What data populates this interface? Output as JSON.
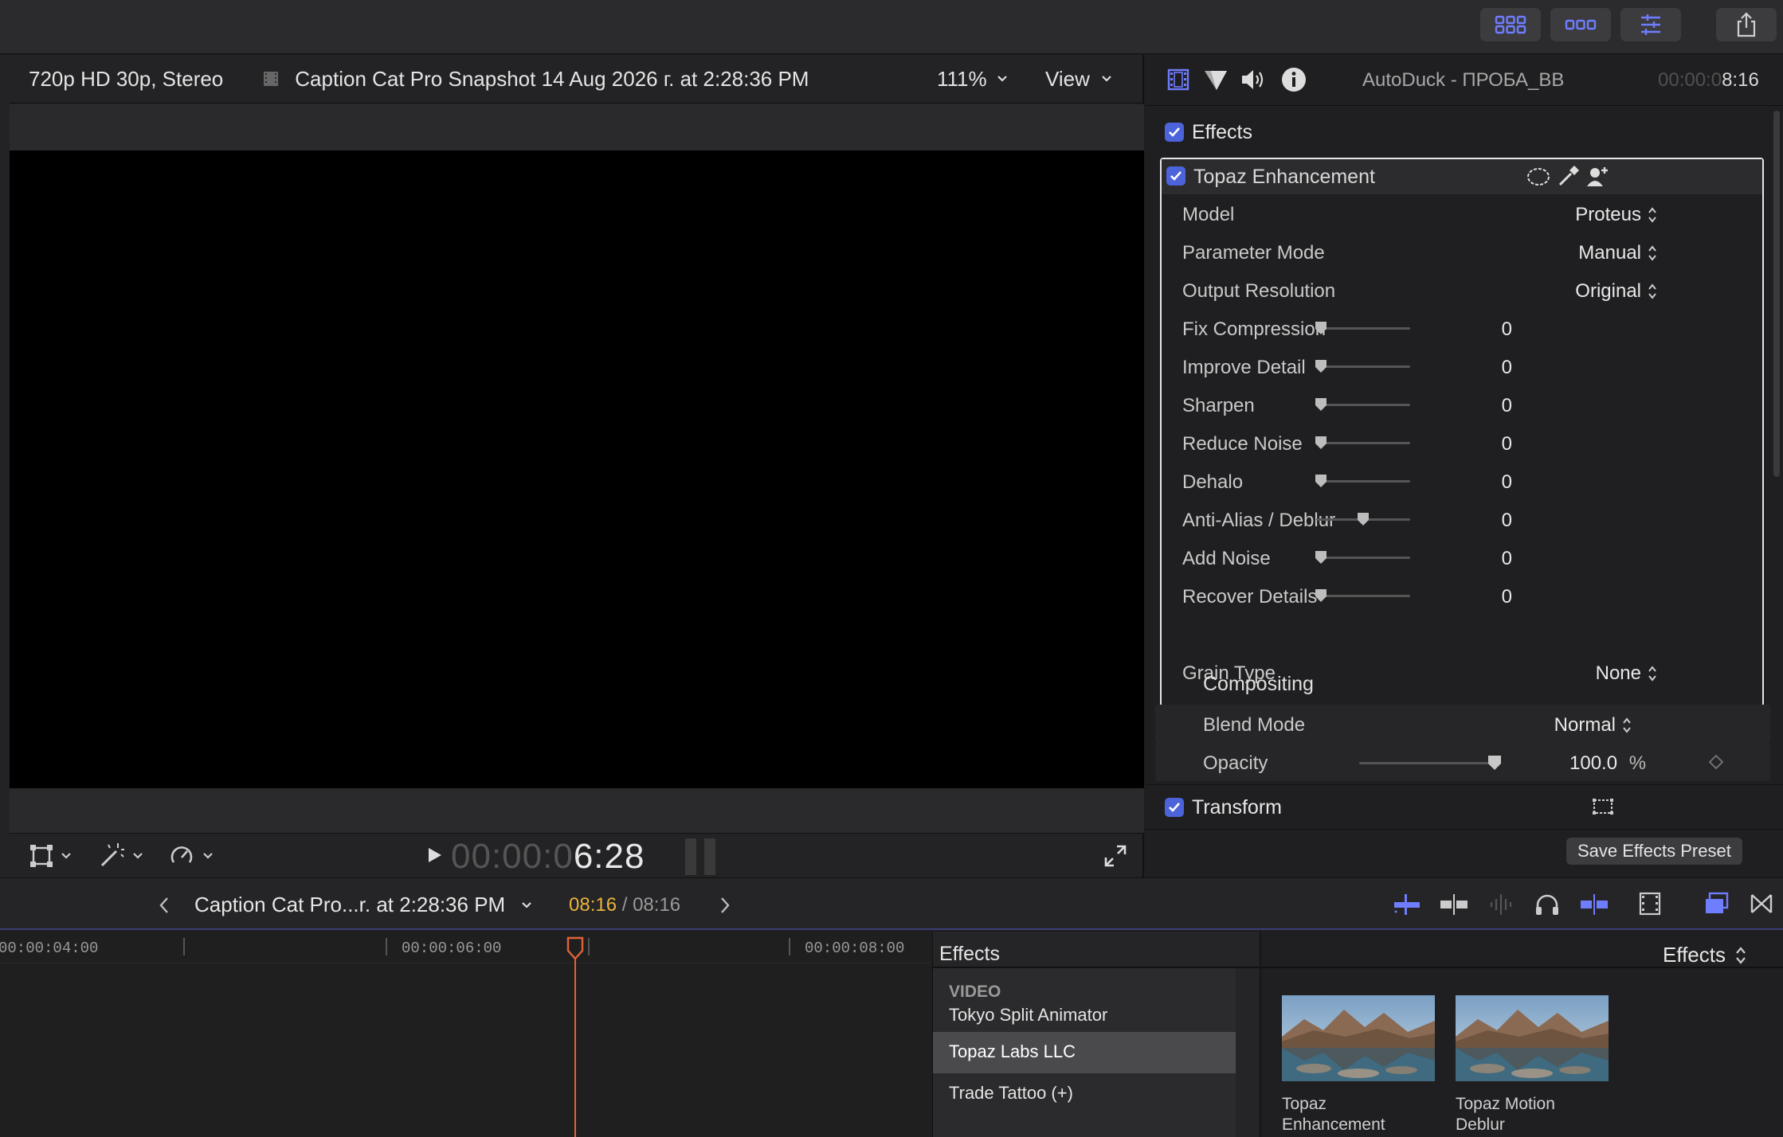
{
  "toolbar": {
    "icons": [
      "grid-layout-icon",
      "filmstrip-layout-icon",
      "inspector-sliders-icon",
      "share-icon"
    ],
    "accent": "#6f7dff"
  },
  "viewer": {
    "format": "720p HD 30p, Stereo",
    "clip_title": "Caption Cat Pro Snapshot 14 Aug 2026 г. at 2:28:36 PM",
    "zoom": "111%",
    "view_label": "View",
    "timecode_dim": "00:00:0",
    "timecode_bright": "6:28"
  },
  "inspector": {
    "title": "AutoDuck - ПРОБА_ВВ",
    "duration_dim": "00:00:0",
    "duration_bright": "8:16",
    "effects_label": "Effects",
    "effect_name": "Topaz Enhancement",
    "popups": [
      {
        "label": "Model",
        "value": "Proteus"
      },
      {
        "label": "Parameter Mode",
        "value": "Manual"
      },
      {
        "label": "Output Resolution",
        "value": "Original"
      }
    ],
    "sliders": [
      {
        "label": "Fix Compression",
        "value": "0",
        "level": 0.0
      },
      {
        "label": "Improve Detail",
        "value": "0",
        "level": 0.0
      },
      {
        "label": "Sharpen",
        "value": "0",
        "level": 0.0
      },
      {
        "label": "Reduce Noise",
        "value": "0",
        "level": 0.0
      },
      {
        "label": "Dehalo",
        "value": "0",
        "level": 0.0
      },
      {
        "label": "Anti-Alias / Deblur",
        "value": "0",
        "level": 0.5
      },
      {
        "label": "Add Noise",
        "value": "0",
        "level": 0.0
      },
      {
        "label": "Recover Details",
        "value": "0",
        "level": 0.0
      }
    ],
    "grain": {
      "label": "Grain Type",
      "value": "None"
    },
    "compositing_label": "Compositing",
    "blend": {
      "label": "Blend Mode",
      "value": "Normal"
    },
    "opacity": {
      "label": "Opacity",
      "value": "100.0",
      "unit": "%",
      "level": 1.0
    },
    "transform_label": "Transform",
    "save_preset_label": "Save Effects Preset"
  },
  "timeline_bar": {
    "project": "Caption Cat Pro...r. at 2:28:36 PM",
    "position": "08:16",
    "separator": " / ",
    "total": "08:16"
  },
  "timeline": {
    "ticks": [
      "00:00:04:00",
      "00:00:06:00",
      "00:00:08:00"
    ],
    "playhead_color": "#e0623a"
  },
  "effects_browser": {
    "sidebar_title": "Effects",
    "section": "VIDEO",
    "items": [
      "Tokyo Split Animator",
      "Topaz Labs LLC",
      "Trade Tattoo (+)"
    ],
    "selected_index": 1,
    "main_title": "Effects",
    "thumbnails": [
      {
        "line1": "Topaz",
        "line2": "Enhancement"
      },
      {
        "line1": "Topaz Motion",
        "line2": "Deblur"
      }
    ]
  }
}
